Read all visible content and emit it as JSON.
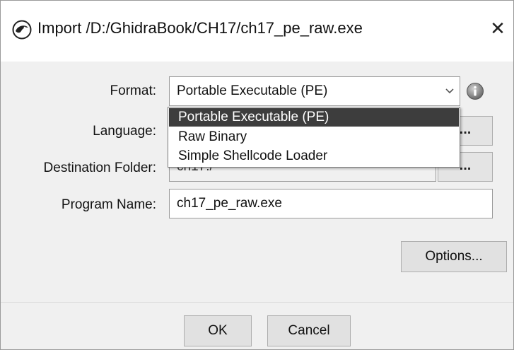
{
  "window": {
    "title": "Import /D:/GhidraBook/CH17/ch17_pe_raw.exe",
    "close_glyph": "✕",
    "app_icon": "ghidra-dragon-icon"
  },
  "form": {
    "format_label": "Format:",
    "format_value": "Portable Executable (PE)",
    "language_label": "Language:",
    "destination_label": "Destination Folder:",
    "destination_value": "ch17:/",
    "program_name_label": "Program Name:",
    "program_name_value": "ch17_pe_raw.exe",
    "browse_glyph": "...",
    "info_icon": "info-icon",
    "options_label": "Options..."
  },
  "format_dropdown": {
    "options": [
      "Portable Executable (PE)",
      "Raw Binary",
      "Simple Shellcode Loader"
    ],
    "selected": "Portable Executable (PE)"
  },
  "footer": {
    "ok_label": "OK",
    "cancel_label": "Cancel"
  },
  "colors": {
    "selection": "#3d3d3d",
    "panel": "#f0f0f0"
  }
}
